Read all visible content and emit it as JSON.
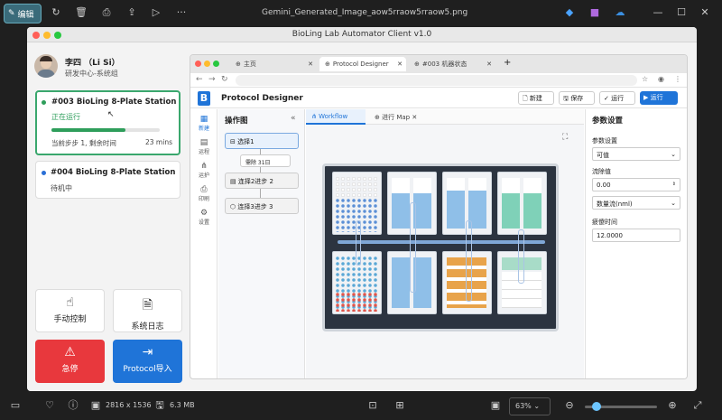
{
  "viewer": {
    "edit_label": "编辑",
    "filename": "Gemini_Generated_Image_aow5rraow5rraow5.png",
    "dimensions": "2816 x 1536",
    "filesize": "6.3 MB",
    "zoom": "63%"
  },
  "app": {
    "title": "BioLing Lab Automator Client v1.0",
    "user": {
      "name": "李四 （Li Si）",
      "dept": "研发中心-系统组"
    },
    "stations": [
      {
        "name": "#003 BioLing 8-Plate Station",
        "status": "正在运行",
        "progress_text": "当前步步 1, 剩余时间",
        "time": "23 mins",
        "progress": 0.68,
        "status_color": "#2e9e5b"
      },
      {
        "name": "#004 BioLing 8-Plate Station",
        "status": "待机中",
        "status_color": "#2a6fd6"
      }
    ],
    "buttons": {
      "manual": "手动控制",
      "log": "系统日志",
      "stop": "急停",
      "import": "Protocol导入"
    }
  },
  "browser": {
    "tabs": [
      "主页",
      "Protocol Designer",
      "#003 机器状态"
    ],
    "header_title": "Protocol Designer",
    "actions": {
      "new": "新建",
      "save": "保存",
      "run_check": "运行",
      "run": "运行"
    },
    "sidebar": [
      "新建",
      "运程",
      "运护",
      "印刷",
      "设置"
    ],
    "panel_title": "操作图",
    "nodes": [
      "选择1",
      "需除 31日",
      "连择2进步 2",
      "连择3进步 3"
    ],
    "canvas_tabs": [
      "Workflow",
      "进行 Map"
    ],
    "params": {
      "title": "参数设置",
      "label1": "参数设置",
      "value1": "可值",
      "label2": "流除值",
      "value2": "0.00",
      "value3": "数量流(nml)",
      "label4": "疲傻时间",
      "value4": "12.0000"
    }
  }
}
